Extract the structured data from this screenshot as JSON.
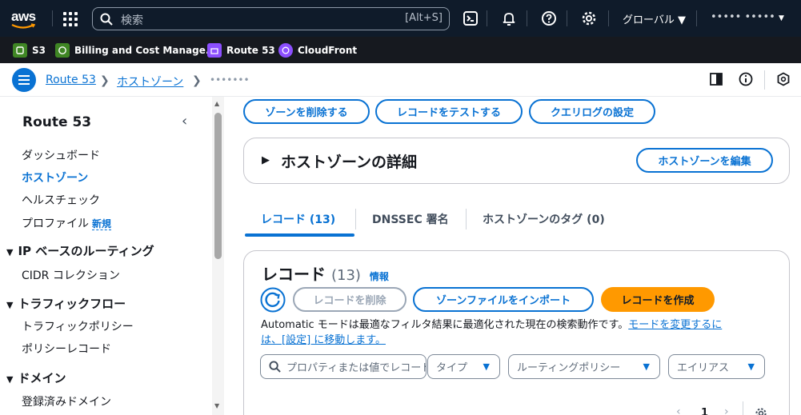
{
  "topnav": {
    "logo_text": "aws",
    "search_placeholder": "検索",
    "search_shortcut": "[Alt+S]",
    "region_label": "グローバル",
    "account_label": "••••• •••••"
  },
  "favorites": [
    {
      "label": "S3",
      "color": "#3f8624"
    },
    {
      "label": "Billing and Cost Manage...",
      "color": "#3f8624"
    },
    {
      "label": "Route 53",
      "color": "#8c4fff"
    },
    {
      "label": "CloudFront",
      "color": "#8c4fff"
    }
  ],
  "breadcrumb": {
    "items": [
      "Route 53",
      "ホストゾーン"
    ],
    "current": "•••••••"
  },
  "sidebar": {
    "title": "Route 53",
    "items_top": [
      "ダッシュボード",
      "ホストゾーン",
      "ヘルスチェック",
      "プロファイル"
    ],
    "new_badge": "新規",
    "section_ip": "IP ベースのルーティング",
    "ip_items": [
      "CIDR コレクション"
    ],
    "section_traffic": "トラフィックフロー",
    "traffic_items": [
      "トラフィックポリシー",
      "ポリシーレコード"
    ],
    "section_domain": "ドメイン",
    "domain_items": [
      "登録済みドメイン"
    ]
  },
  "main": {
    "actions": [
      "ゾーンを削除する",
      "レコードをテストする",
      "クエリログの設定"
    ],
    "details_title": "ホストゾーンの詳細",
    "edit_zone": "ホストゾーンを編集",
    "tabs": [
      "レコード (13)",
      "DNSSEC 署名",
      "ホストゾーンのタグ (0)"
    ],
    "records": {
      "title": "レコード",
      "count": "(13)",
      "info": "情報",
      "delete_btn": "レコードを削除",
      "import_btn": "ゾーンファイルをインポート",
      "create_btn": "レコードを作成",
      "mode_text": "Automatic モードは最適なフィルタ結果に最適化された現在の検索動作です。",
      "mode_link1": "モードを変更するに",
      "mode_link2": "は、[設定] に移動します。",
      "search_placeholder": "プロパティまたは値でレコードを",
      "filter_type": "タイプ",
      "filter_routing": "ルーティングポリシー",
      "filter_alias": "エイリアス",
      "page": "1"
    }
  },
  "colors": {
    "accent": "#0972d3",
    "primary": "#ff9900",
    "nav": "#0f1b2a"
  }
}
